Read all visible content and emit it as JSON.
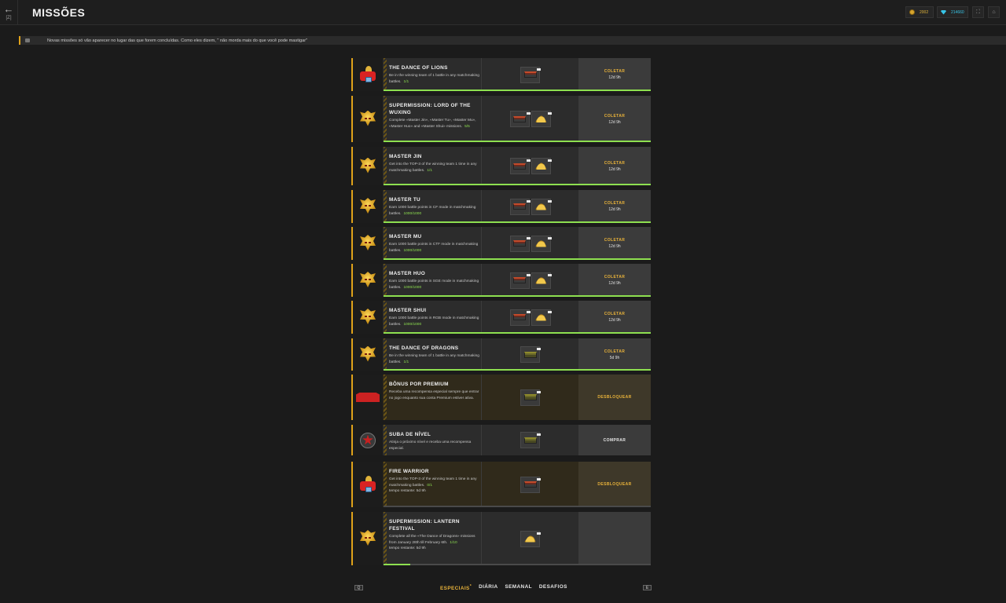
{
  "header": {
    "back_key": "[Z]",
    "title": "MISSÕES",
    "gold": "2002",
    "gems": "214660"
  },
  "news": "Novas missões só vão aparecer no lugar das que forem concluídas. Como eles dizem, \" não morda mais do que você pode mastigar\"",
  "missions": [
    {
      "title": "THE DANCE OF LIONS",
      "desc": "Be in the winning team of 1 battle in any matchmaking battles.",
      "progress": "1/1",
      "action": "COLETAR",
      "time": "12d 9h",
      "icon": "lion",
      "rewards": [
        "chest-red"
      ],
      "fill": 1
    },
    {
      "title": "SUPERMISSION: LORD OF THE WUXING",
      "desc": "Complete «Master Jin», «Master Tu», «Master Mu», «Master Huo» and «Master Shui» missions.",
      "progress": "5/5",
      "action": "COLETAR",
      "time": "12d 9h",
      "icon": "dragon",
      "rewards": [
        "chest-red",
        "gold"
      ],
      "fill": 1
    },
    {
      "title": "MASTER JIN",
      "desc": "Get into the TOP-3 of the winning team 1 time in any matchmaking battles.",
      "progress": "1/1",
      "action": "COLETAR",
      "time": "12d 9h",
      "icon": "dragon",
      "rewards": [
        "chest-red",
        "gold"
      ],
      "fill": 1
    },
    {
      "title": "MASTER TU",
      "desc": "Earn 1000 battle points in CF mode in matchmaking battles.",
      "progress": "1000/1000",
      "action": "COLETAR",
      "time": "12d 9h",
      "icon": "dragon",
      "rewards": [
        "chest-red",
        "gold"
      ],
      "fill": 1
    },
    {
      "title": "MASTER MU",
      "desc": "Earn 1000 battle points in CTF mode in matchmaking battles.",
      "progress": "1000/1000",
      "action": "COLETAR",
      "time": "12d 9h",
      "icon": "dragon",
      "rewards": [
        "chest-red",
        "gold"
      ],
      "fill": 1
    },
    {
      "title": "MASTER HUO",
      "desc": "Earn 1000 battle points in SGE mode in matchmaking battles.",
      "progress": "1000/1000",
      "action": "COLETAR",
      "time": "12d 9h",
      "icon": "dragon",
      "rewards": [
        "chest-red",
        "gold"
      ],
      "fill": 1
    },
    {
      "title": "MASTER SHUI",
      "desc": "Earn 1000 battle points in RGB mode in matchmaking battles.",
      "progress": "1000/1000",
      "action": "COLETAR",
      "time": "12d 9h",
      "icon": "dragon",
      "rewards": [
        "chest-red",
        "gold"
      ],
      "fill": 1
    },
    {
      "title": "THE DANCE OF DRAGONS",
      "desc": "Be in the winning team of 1 battle in any matchmaking battles.",
      "progress": "1/1",
      "action": "COLETAR",
      "time": "5d 9h",
      "icon": "dragon",
      "rewards": [
        "chest-green"
      ],
      "fill": 1
    },
    {
      "title": "BÔNUS POR PREMIUM",
      "desc": "Receba uma recompensa especial sempre que entrar no jogo enquanto sua conta Premium estiver ativa.",
      "progress": "",
      "action": "DESBLOQUEAR",
      "time": "",
      "icon": "premium",
      "rewards": [
        "chest-green"
      ],
      "fill": null
    },
    {
      "title": "SUBA DE NÍVEL",
      "desc": "Atinja o próximo nível e receba uma recompensa especial.",
      "progress": "",
      "action": "COMPRAR",
      "time": "",
      "icon": "star",
      "rewards": [
        "chest-green"
      ],
      "fill": null
    },
    {
      "title": "FIRE WARRIOR",
      "desc": "Get into the TOP-3 of the winning team 1 time in any matchmaking battles.",
      "progress": "0/1",
      "action": "DESBLOQUEAR",
      "time": "",
      "remaining": "tempo restante: 5d 9h",
      "icon": "lion",
      "rewards": [
        "chest-red"
      ],
      "fill": 0
    },
    {
      "title": "SUPERMISSION: LANTERN FESTIVAL",
      "desc": "Complete all the «The Dance of Dragons» missions from January 28th till February 6th.",
      "progress": "1/10",
      "action": "",
      "time": "",
      "remaining": "tempo restante: 5d 9h",
      "icon": "dragon",
      "rewards": [
        "gold"
      ],
      "fill": 0.1
    }
  ],
  "tabs": {
    "prev": "Q",
    "next": "E",
    "items": [
      {
        "label": "ESPECIAIS",
        "active": true,
        "mark": "*"
      },
      {
        "label": "DIÁRIA",
        "active": false,
        "mark": ""
      },
      {
        "label": "SEMANAL",
        "active": false,
        "mark": ""
      },
      {
        "label": "DESAFIOS",
        "active": false,
        "mark": ""
      }
    ]
  },
  "colors": {
    "accent": "#e0a21a",
    "progress": "#8ee050",
    "background": "#1b1b1b"
  }
}
